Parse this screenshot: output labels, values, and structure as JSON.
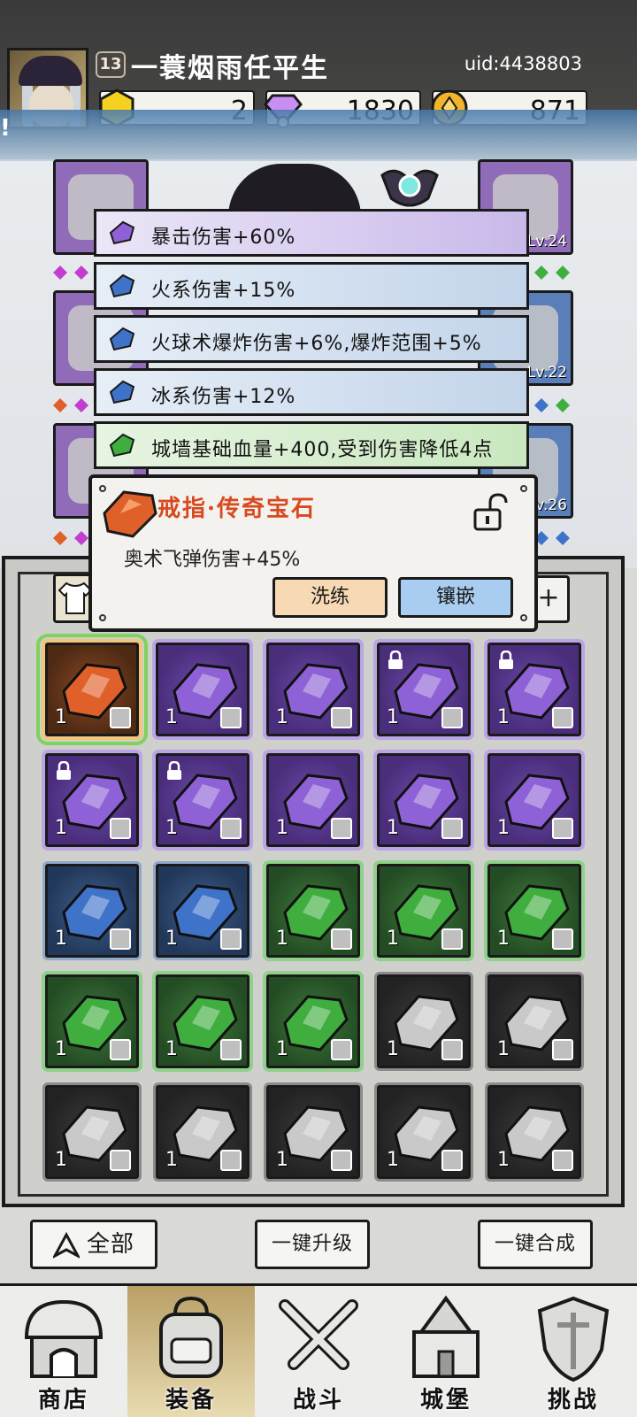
{
  "player": {
    "level": "13",
    "name": "一蓑烟雨任平生",
    "uid": "uid:4438803"
  },
  "currencies": [
    {
      "icon": "gold-hexagon-icon",
      "value": "2"
    },
    {
      "icon": "diamond-icon",
      "value": "1830"
    },
    {
      "icon": "coin-icon",
      "value": "871"
    }
  ],
  "band_mark": "!",
  "equipment_slots": [
    {
      "icon": "helmet-icon",
      "level": ""
    },
    {
      "icon": "bracer-icon",
      "level": "Lv.24"
    },
    {
      "icon": "scarf-icon",
      "level": ""
    },
    {
      "icon": "belt-icon",
      "level": "Lv.22"
    },
    {
      "icon": "ring-icon",
      "level": ""
    },
    {
      "icon": "boots-icon",
      "level": "Lv.26"
    }
  ],
  "stats": [
    {
      "gem": "purple",
      "text": "暴击伤害+60%"
    },
    {
      "gem": "blue",
      "text": "火系伤害+15%"
    },
    {
      "gem": "blue",
      "text": "火球术爆炸伤害+6%,爆炸范围+5%"
    },
    {
      "gem": "blue",
      "text": "冰系伤害+12%"
    },
    {
      "gem": "green",
      "text": "城墙基础血量+400,受到伤害降低4点"
    }
  ],
  "gem_popup": {
    "title": "戒指·传奇宝石",
    "stat": "奥术飞弹伤害+45%",
    "refine_label": "洗练",
    "inlay_label": "镶嵌"
  },
  "inventory_add": "+",
  "inventory": [
    {
      "color": "orange",
      "qty": "1",
      "locked": false
    },
    {
      "color": "purple",
      "qty": "1",
      "locked": false
    },
    {
      "color": "purple",
      "qty": "1",
      "locked": false
    },
    {
      "color": "purple",
      "qty": "1",
      "locked": true
    },
    {
      "color": "purple",
      "qty": "1",
      "locked": true
    },
    {
      "color": "purple",
      "qty": "1",
      "locked": true
    },
    {
      "color": "purple",
      "qty": "1",
      "locked": true
    },
    {
      "color": "purple",
      "qty": "1",
      "locked": false
    },
    {
      "color": "purple",
      "qty": "1",
      "locked": false
    },
    {
      "color": "purple",
      "qty": "1",
      "locked": false
    },
    {
      "color": "blue",
      "qty": "1",
      "locked": false
    },
    {
      "color": "blue",
      "qty": "1",
      "locked": false
    },
    {
      "color": "green",
      "qty": "1",
      "locked": false
    },
    {
      "color": "green",
      "qty": "1",
      "locked": false
    },
    {
      "color": "green",
      "qty": "1",
      "locked": false
    },
    {
      "color": "green",
      "qty": "1",
      "locked": false
    },
    {
      "color": "green",
      "qty": "1",
      "locked": false
    },
    {
      "color": "green",
      "qty": "1",
      "locked": false
    },
    {
      "color": "gray",
      "qty": "1",
      "locked": false
    },
    {
      "color": "gray",
      "qty": "1",
      "locked": false
    },
    {
      "color": "gray",
      "qty": "1",
      "locked": false
    },
    {
      "color": "gray",
      "qty": "1",
      "locked": false
    },
    {
      "color": "gray",
      "qty": "1",
      "locked": false
    },
    {
      "color": "gray",
      "qty": "1",
      "locked": false
    },
    {
      "color": "gray",
      "qty": "1",
      "locked": false
    }
  ],
  "actions": {
    "filter_label": "全部",
    "upgrade_label": "一键升级",
    "merge_label": "一键合成"
  },
  "nav": [
    {
      "icon": "shop-icon",
      "label": "商店",
      "active": false
    },
    {
      "icon": "backpack-icon",
      "label": "装备",
      "active": true
    },
    {
      "icon": "crossed-swords-icon",
      "label": "战斗",
      "active": false
    },
    {
      "icon": "castle-icon",
      "label": "城堡",
      "active": false
    },
    {
      "icon": "shield-icon",
      "label": "挑战",
      "active": false
    }
  ],
  "colors": {
    "purple_gem": "#8e62d6",
    "blue_gem": "#3f73c9",
    "green_gem": "#3fae3f",
    "gray_gem": "#c9c9c9",
    "orange_gem": "#e0602a",
    "title_red": "#d8491f"
  }
}
